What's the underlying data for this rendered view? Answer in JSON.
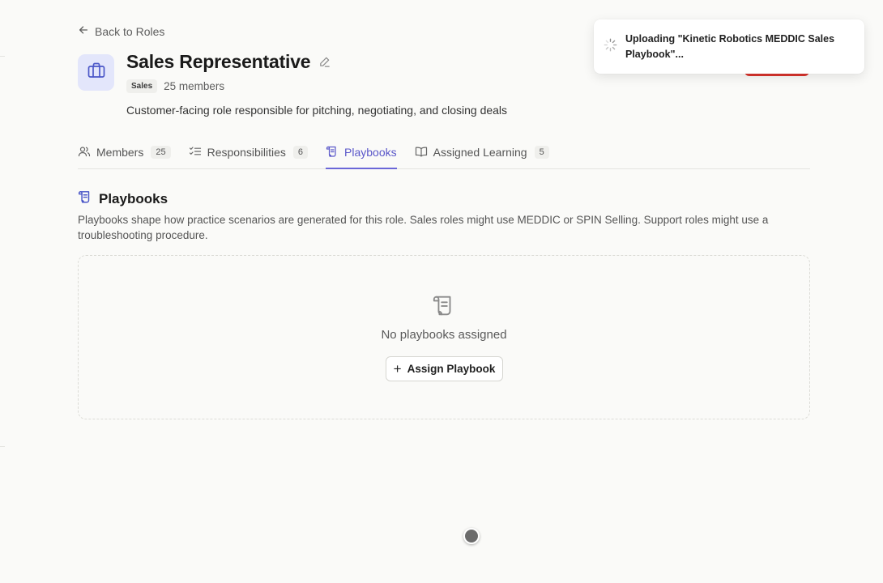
{
  "nav": {
    "back_label": "Back to Roles"
  },
  "role": {
    "title": "Sales Representative",
    "department_badge": "Sales",
    "member_count": "25 members",
    "description": "Customer-facing role responsible for pitching, negotiating, and closing deals",
    "icon": "briefcase-icon"
  },
  "tabs": [
    {
      "label": "Members",
      "count": "25",
      "icon": "users-icon"
    },
    {
      "label": "Responsibilities",
      "count": "6",
      "icon": "list-check-icon"
    },
    {
      "label": "Playbooks",
      "count": "",
      "icon": "scroll-icon",
      "active": true
    },
    {
      "label": "Assigned Learning",
      "count": "5",
      "icon": "book-open-icon"
    }
  ],
  "playbooks": {
    "title": "Playbooks",
    "description": "Playbooks shape how practice scenarios are generated for this role. Sales roles might use MEDDIC or SPIN Selling. Support roles might use a troubleshooting procedure.",
    "empty_text": "No playbooks assigned",
    "assign_button": "Assign Playbook"
  },
  "toast": {
    "message": "Uploading \"Kinetic Robotics MEDDIC Sales Playbook\"..."
  },
  "colors": {
    "accent": "#5a57c9",
    "icon_bg": "#e3e6fb",
    "danger": "#d8342c"
  }
}
